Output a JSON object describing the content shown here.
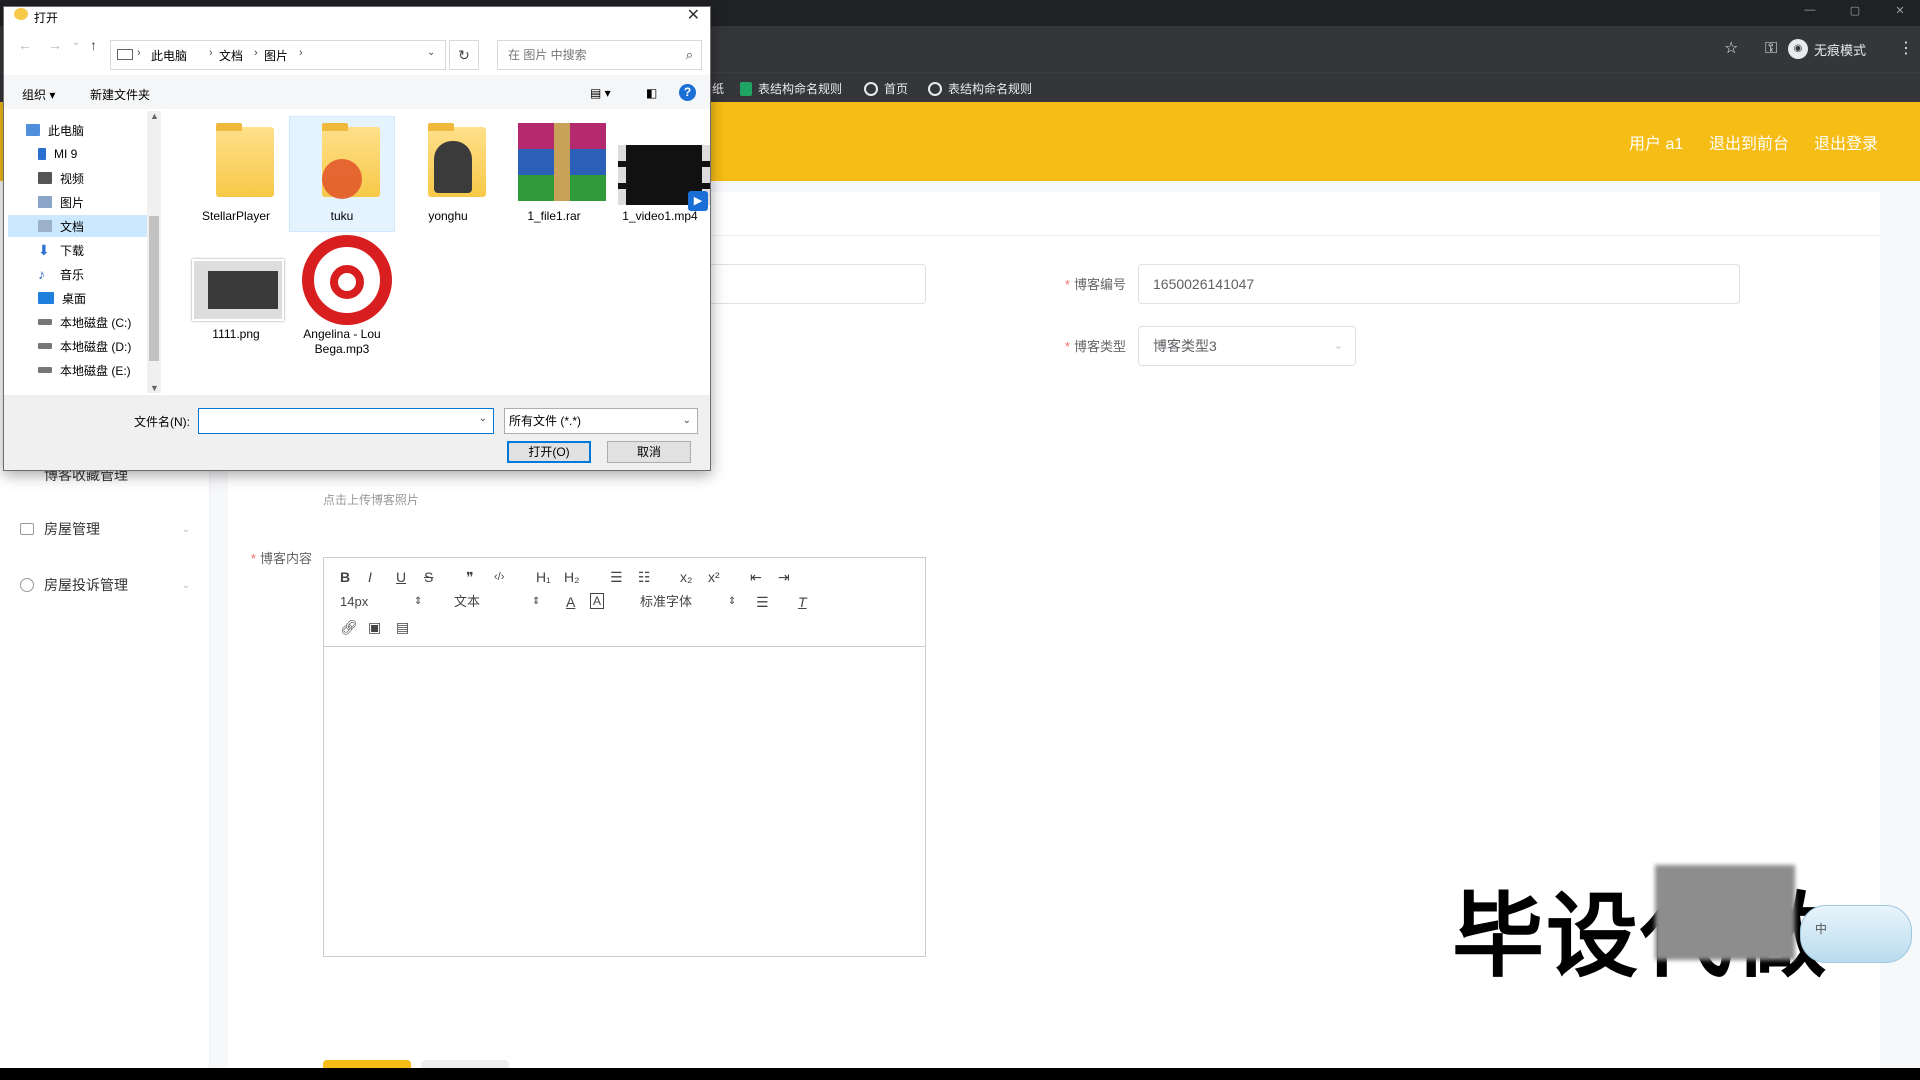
{
  "browser": {
    "incognito_label": "无痕模式",
    "bookmarks": [
      {
        "label": "纸",
        "icon": "bookmark-fragment"
      },
      {
        "label": "表结构命名规则",
        "icon": "sheet-icon"
      },
      {
        "label": "首页",
        "icon": "globe-icon"
      },
      {
        "label": "表结构命名规则",
        "icon": "globe-icon"
      }
    ]
  },
  "header": {
    "user": "用户 a1",
    "back_to_front": "退出到前台",
    "logout": "退出登录",
    "color": "#f6bd16"
  },
  "sidebar": {
    "items": [
      {
        "label": "博客收藏管理",
        "icon": "folder-icon"
      },
      {
        "label": "房屋管理",
        "icon": "list-icon"
      },
      {
        "label": "房屋投诉管理",
        "icon": "power-icon"
      }
    ]
  },
  "form": {
    "blog_no_label": "博客编号",
    "blog_no_value": "1650026141047",
    "blog_type_label": "博客类型",
    "blog_type_value": "博客类型3",
    "upload_hint": "点击上传博客照片",
    "content_label": "博客内容"
  },
  "editor": {
    "font_size": "14px",
    "block_type": "文本",
    "font_family": "标准字体",
    "tools_row1": [
      "B",
      "I",
      "U",
      "S",
      "❞",
      "‹/›",
      "H₁",
      "H₂",
      "☰",
      "☷",
      "x₂",
      "x²",
      "⇤",
      "⇥"
    ]
  },
  "watermark": {
    "text": "毕设代做"
  },
  "ime": {
    "label": "中"
  },
  "dialog": {
    "title": "打开",
    "breadcrumbs": [
      "此电脑",
      "文档",
      "图片"
    ],
    "search_placeholder": "在 图片 中搜索",
    "organize": "组织 ▾",
    "new_folder": "新建文件夹",
    "help": "?",
    "nav_tree": [
      {
        "label": "此电脑",
        "icon": "computer-icon"
      },
      {
        "label": "MI 9",
        "icon": "phone-icon"
      },
      {
        "label": "视频",
        "icon": "video-folder-icon"
      },
      {
        "label": "图片",
        "icon": "picture-folder-icon"
      },
      {
        "label": "文档",
        "icon": "document-folder-icon"
      },
      {
        "label": "下载",
        "icon": "download-icon"
      },
      {
        "label": "音乐",
        "icon": "music-icon"
      },
      {
        "label": "桌面",
        "icon": "desktop-icon"
      },
      {
        "label": "本地磁盘 (C:)",
        "icon": "drive-icon"
      },
      {
        "label": "本地磁盘 (D:)",
        "icon": "drive-icon"
      },
      {
        "label": "本地磁盘 (E:)",
        "icon": "drive-icon"
      }
    ],
    "files": [
      {
        "name": "StellarPlayer",
        "type": "folder"
      },
      {
        "name": "tuku",
        "type": "folder"
      },
      {
        "name": "yonghu",
        "type": "folder"
      },
      {
        "name": "1_file1.rar",
        "type": "rar"
      },
      {
        "name": "1_video1.mp4",
        "type": "video"
      },
      {
        "name": "1111.png",
        "type": "image"
      },
      {
        "name": "Angelina - Lou Bega.mp3",
        "type": "audio"
      }
    ],
    "filename_label": "文件名(N):",
    "filename_value": "",
    "filetype_value": "所有文件 (*.*)",
    "open_button": "打开(O)",
    "cancel_button": "取消"
  }
}
